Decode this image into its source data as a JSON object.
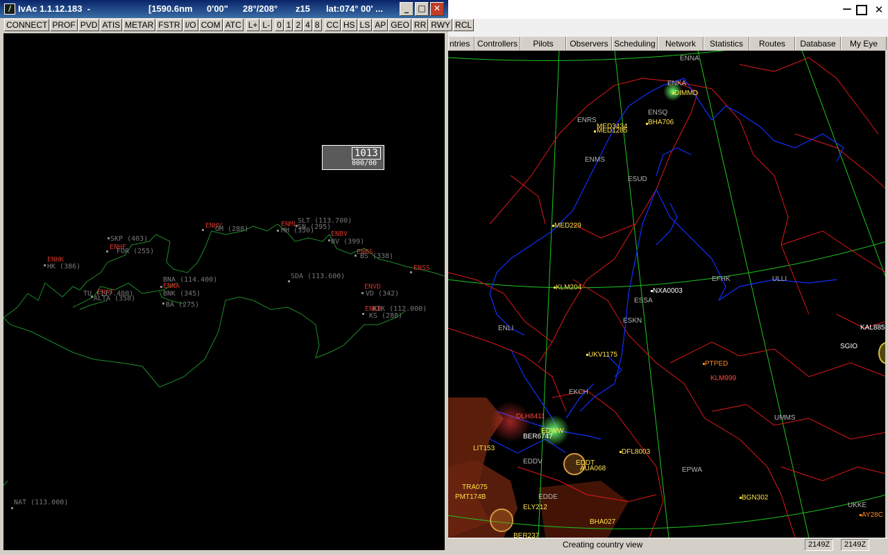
{
  "left_window": {
    "title": {
      "app": "IvAc 1.1.12.183  -",
      "range": "[1590.6nm",
      "angle": "0'00\"",
      "bearing": "28°/208°",
      "zoom": "z15",
      "lat": "lat:074° 00' ..."
    },
    "toolbar": [
      "CONNECT",
      "PROF",
      "PVD",
      "ATIS",
      "METAR",
      "FSTR",
      "I/O",
      "COM",
      "ATC",
      "L+",
      "L-",
      "0",
      "1",
      "2",
      "4",
      "8",
      "CC",
      "HS",
      "LS",
      "AP",
      "GEO",
      "RR",
      "RWY",
      "RCL"
    ],
    "info_box": {
      "line1": "1013",
      "line2": "000/00"
    },
    "navaids": [
      {
        "code": "ENHV",
        "freq": "OM (288)",
        "color": "red",
        "label_color": "grey"
      },
      {
        "code": "ENML",
        "freq": "MH (350)",
        "color": "red",
        "label_color": "grey"
      },
      {
        "code": "SLT (113.700)",
        "freq": "",
        "color": "grey"
      },
      {
        "code": "SN (295)",
        "freq": "",
        "color": "grey"
      },
      {
        "code": "ENBV",
        "freq": "BV (399)",
        "color": "red"
      },
      {
        "code": "SKP (403)",
        "freq": "",
        "color": "grey"
      },
      {
        "code": "ENHF",
        "freq": "FOR (255)",
        "color": "red"
      },
      {
        "code": "ENBS",
        "freq": "BS (338)",
        "color": "red"
      },
      {
        "code": "ENHK",
        "freq": "HK (386)",
        "color": "red"
      },
      {
        "code": "ENSS",
        "freq": "ENSS",
        "color": "red"
      },
      {
        "code": "BNA (114.400)",
        "freq": "",
        "color": "grey"
      },
      {
        "code": "ENNA",
        "freq": "BNK (345)",
        "color": "red"
      },
      {
        "code": "SDA (113.600)",
        "freq": "",
        "color": "grey"
      },
      {
        "code": "ENAT",
        "freq": "ALTA (358)",
        "color": "red"
      },
      {
        "code": "TU (117.400)",
        "freq": "",
        "color": "grey"
      },
      {
        "code": "ENVD",
        "freq": "VD (342)",
        "color": "red"
      },
      {
        "code": "BA (275)",
        "freq": "",
        "color": "grey"
      },
      {
        "code": "ENKR",
        "freq": "KIK (112.000)",
        "color": "red"
      },
      {
        "code": "KS (288)",
        "freq": "",
        "color": "grey"
      },
      {
        "code": "NAT (113.000)",
        "freq": "",
        "color": "grey"
      }
    ]
  },
  "right_window": {
    "tabs": [
      "ntries",
      "Controllers",
      "Pilots",
      "Observers",
      "Scheduling",
      "Network",
      "Statistics",
      "Routes",
      "Database",
      "My Eye"
    ],
    "status": {
      "message": "Creating country view",
      "zulu1": "2149Z",
      "zulu2": "2149Z"
    },
    "airports": [
      "ENNA",
      "ENKA",
      "ENSQ",
      "ENRS",
      "ENMS",
      "ESUD",
      "EFHK",
      "ULLI",
      "ESSA",
      "ESKN",
      "ENLI",
      "EKCH",
      "UMMS",
      "EPWA",
      "EDDV",
      "EDDE",
      "UKKE",
      "EDDT"
    ],
    "flights": [
      {
        "callsign": "DIMMD",
        "type": "pl"
      },
      {
        "callsign": "MED3434",
        "type": "pl"
      },
      {
        "callsign": "MED1285",
        "type": "pl"
      },
      {
        "callsign": "BHA706",
        "type": "pl"
      },
      {
        "callsign": "MED229",
        "type": "pl"
      },
      {
        "callsign": "KLM204",
        "type": "pl"
      },
      {
        "callsign": "NXA0003",
        "type": "ap"
      },
      {
        "callsign": "UKV1175",
        "type": "pl"
      },
      {
        "callsign": "KAL885",
        "type": "ap"
      },
      {
        "callsign": "SGIO",
        "type": "ap"
      },
      {
        "callsign": "PTPED",
        "type": "pr"
      },
      {
        "callsign": "KLM999",
        "type": "rd"
      },
      {
        "callsign": "DLH8411",
        "type": "rd"
      },
      {
        "callsign": "EDWW",
        "type": "pl"
      },
      {
        "callsign": "BER6747",
        "type": "ap"
      },
      {
        "callsign": "DFL8003",
        "type": "pl"
      },
      {
        "callsign": "AUA068",
        "type": "pl"
      },
      {
        "callsign": "BGN302",
        "type": "pl"
      },
      {
        "callsign": "ELY212",
        "type": "pl"
      },
      {
        "callsign": "AY28C",
        "type": "pr"
      },
      {
        "callsign": "BER237",
        "type": "pl"
      },
      {
        "callsign": "BHA027",
        "type": "pl"
      },
      {
        "callsign": "LIT153",
        "type": "pl"
      },
      {
        "callsign": "TRA075",
        "type": "pl"
      },
      {
        "callsign": "PMT174B",
        "type": "pl"
      }
    ]
  }
}
